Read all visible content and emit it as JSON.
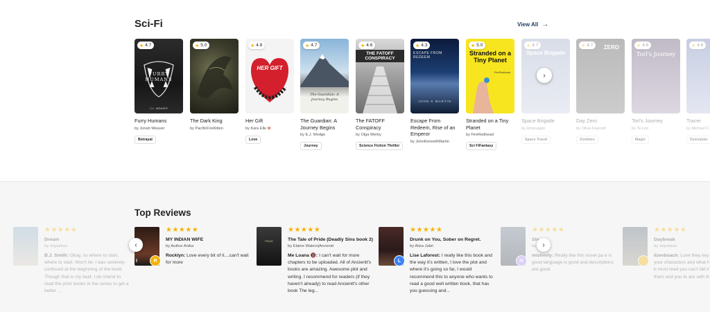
{
  "scifi": {
    "title": "Sci-Fi",
    "view_all": "View All",
    "books": [
      {
        "title": "Furry Humans",
        "author": "by Joriah Weaver",
        "rating": "4.7",
        "tag": "Betrayal",
        "cover_text": "FURRY HUMANS",
        "cover_sub": "C.L. WEAVER"
      },
      {
        "title": "The Dark King",
        "author": "by PacificFireKitten",
        "rating": "5.0",
        "tag": "",
        "cover_text": "",
        "cover_sub": ""
      },
      {
        "title": "Her Gift",
        "author": "by Kara Elle",
        "rating": "4.8",
        "tag": "Love",
        "cover_text": "HER GIFT",
        "cover_sub": ""
      },
      {
        "title": "The Guardian: A Journey Begins",
        "author": "by E.J. Wedge",
        "rating": "4.7",
        "tag": "Journey",
        "cover_text": "The Guardian: A Journey Begins",
        "cover_sub": ""
      },
      {
        "title": "The FATOFF Conspiracy",
        "author": "by Olga Werby",
        "rating": "4.6",
        "tag": "Science Fiction Thriller",
        "cover_text": "THE FATOFF CONSPIRACY",
        "cover_sub": ""
      },
      {
        "title": "Escape From Redeem, Rise of an Emperor",
        "author": "by JohnKennethMartin",
        "rating": "4.3",
        "tag": "",
        "cover_text": "ESCAPE FROM REDEEM",
        "cover_sub": "JOHN K MARTIN"
      },
      {
        "title": "Stranded on a Tiny Planet",
        "author": "by FireRedhead",
        "rating": "5.0",
        "tag": "Sci FiFantasy",
        "cover_text": "Stranded on a Tiny Planet",
        "cover_sub": "FireRedhead"
      },
      {
        "title": "Space Brigade",
        "author": "by lizzaruggin",
        "rating": "4.7",
        "tag": "Space Travel",
        "cover_text": "Space Brigade",
        "cover_sub": ""
      },
      {
        "title": "Day Zero",
        "author": "by Olivia Fawcett",
        "rating": "4.7",
        "tag": "Zombies",
        "cover_text": "ZERO",
        "cover_sub": ""
      },
      {
        "title": "Torl's Journey",
        "author": "by Ta Leo",
        "rating": "4.8",
        "tag": "Magic",
        "cover_text": "Torl's Journey",
        "cover_sub": ""
      },
      {
        "title": "Tracer",
        "author": "by Michael C",
        "rating": "4.6",
        "tag": "Dystopian",
        "cover_text": "",
        "cover_sub": ""
      }
    ]
  },
  "reviews": {
    "title": "Top Reviews",
    "items": [
      {
        "book": "Dream",
        "author": "by Jxiyseiner",
        "reviewer": "B.J. Smith:",
        "text": "Okay, so where to start, where to start. Won't lie; I was severely confused at the beginning of the book. Though that is my fault. I do intend to read the prior books in the series to get a better ...",
        "avatar": ""
      },
      {
        "book": "MY INDIAN WIFE",
        "author": "by Author Anika",
        "reviewer": "Rocklyn:",
        "text": "Love every bit of it....can't wait for more",
        "avatar": "R"
      },
      {
        "book": "The Tale of Pride (Deadly Sins book 2)",
        "author": "by Elaine Waters|Ancientt",
        "reviewer": "Me Loana 🔞:",
        "text": "I can't wait for more chapters to be uploaded. All of Ancientt's books are amazing. Awesome plot and writing. I recommend for readers (if they haven't already) to read Ancientt's other book The leg...",
        "avatar": ""
      },
      {
        "book": "Drunk on You, Sober on Regret.",
        "author": "by Aliza Jabri",
        "reviewer": "Lise Laforest:",
        "text": "I really like this book and the way it's written, I love the plot and where it's going so far, I would recommend this to anyone who wants to read a good well written book, that has you guessing and...",
        "avatar": "L"
      },
      {
        "book": "Sin...",
        "author": "by ...",
        "reviewer": "mishmily:",
        "text": "Really like this novel pa e is good language is good and descriptions are good",
        "avatar": "M"
      },
      {
        "book": "Daybreak",
        "author": "by Jxiyseiner",
        "reviewer": "lizevboach:",
        "text": "Love they key story about all your characters and what happen All your b must read you can't fall in with all of them and you fe are with them a...",
        "avatar": ""
      }
    ]
  },
  "colors": {
    "star": "#f5b301",
    "accent": "#1e3a5f",
    "review_bg": "#f6f6f6",
    "avatar_r": "#f5b301",
    "avatar_l": "#3b82f6",
    "avatar_m": "#a78bfa"
  },
  "icons": {
    "rating": "star-icon",
    "view_all": "arrow-right-icon",
    "next": "chevron-right-icon",
    "prev": "chevron-left-icon"
  }
}
